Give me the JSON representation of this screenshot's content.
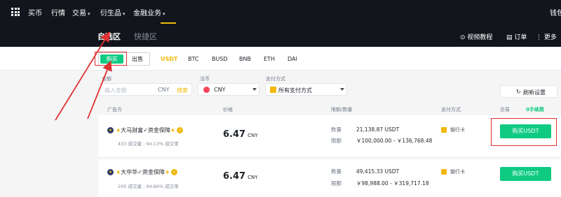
{
  "topnav": {
    "items": [
      "买币",
      "行情",
      "交易",
      "衍生品",
      "金融业务"
    ],
    "right": "钱包"
  },
  "subhead": {
    "tabs": [
      "自选区",
      "快捷区"
    ],
    "links": [
      "视频教程",
      "订单",
      "更多"
    ]
  },
  "filterbar": {
    "buy": "购买",
    "sell": "出售",
    "coins": [
      "USDT",
      "BTC",
      "BUSD",
      "BNB",
      "ETH",
      "DAI"
    ]
  },
  "filters": {
    "amount_label": "金额",
    "amount_placeholder": "输入金额",
    "amount_currency": "CNY",
    "search": "搜索",
    "fiat_label": "法币",
    "fiat_value": "CNY",
    "pay_label": "支付方式",
    "pay_value": "所有支付方式",
    "refresh": "刷新设置"
  },
  "table": {
    "headers": [
      "广告方",
      "价格",
      "限额/数量",
      "支付方式",
      "交易"
    ],
    "zero_fee": "0手续费",
    "rows": [
      {
        "advertiser": "大马财富✓资金保障",
        "orders": "433 成交量",
        "completion": "94.13% 成交率",
        "price": "6.47",
        "currency": "CNY",
        "qty_label": "数量",
        "qty": "21,138.87 USDT",
        "limit_label": "限额",
        "limit": "￥100,000.00 - ￥136,768.48",
        "payment": "银行卡",
        "action": "购买USDT"
      },
      {
        "advertiser": "大中华✓资金保障",
        "orders": "295 成交量",
        "completion": "94.86% 成交率",
        "price": "6.47",
        "currency": "CNY",
        "qty_label": "数量",
        "qty": "49,415.33 USDT",
        "limit_label": "限额",
        "limit": "￥98,988.00 - ￥319,717.18",
        "payment": "银行卡",
        "action": "购买USDT"
      }
    ]
  },
  "colors": {
    "nav_bg": "#12161c",
    "buy_green": "#0ecb81",
    "accent_yellow": "#f0b90b",
    "annotation_red": "#e03131"
  }
}
